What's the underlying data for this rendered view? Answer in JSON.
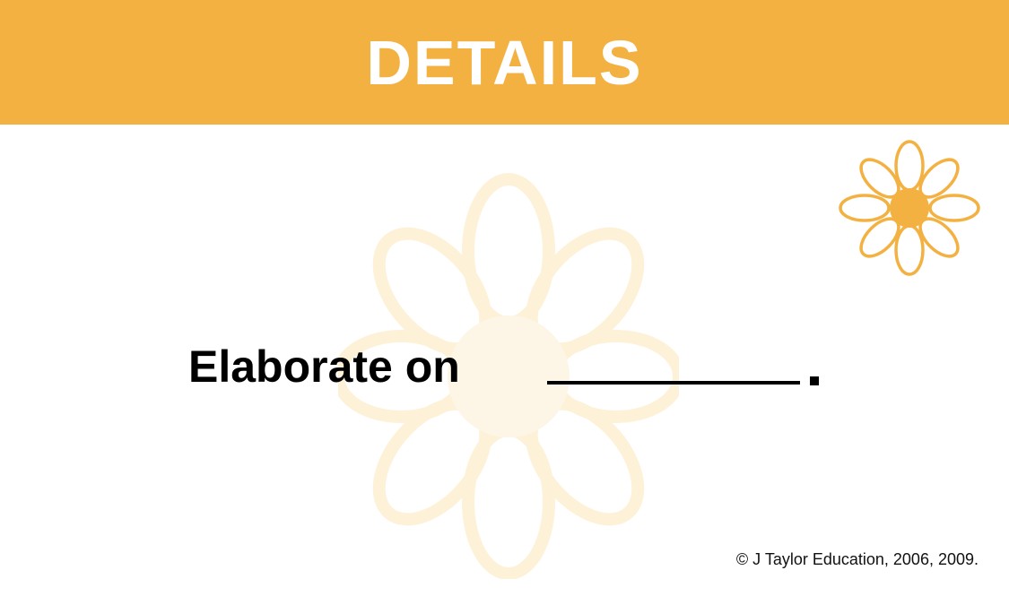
{
  "header": {
    "title": "DETAILS",
    "background_color": "#f3b142",
    "text_color": "#ffffff"
  },
  "prompt": {
    "text": "Elaborate on"
  },
  "footer": {
    "copyright": "© J Taylor Education, 2006, 2009."
  },
  "decorations": {
    "background_flower_icon": "daisy-watermark-icon",
    "background_flower_color": "#fdf1d8",
    "corner_flower_icon": "daisy-icon",
    "corner_flower_color": "#f3b142"
  }
}
